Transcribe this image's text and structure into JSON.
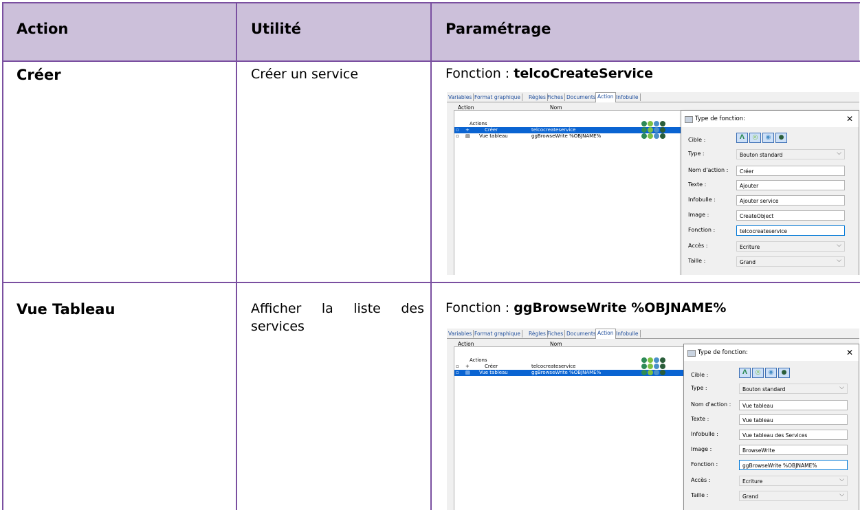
{
  "table": {
    "headers": [
      "Action",
      "Utilité",
      "Paramétrage"
    ],
    "rows": [
      {
        "action": "Créer",
        "utilite": "Créer un service",
        "fn_prefix": "Fonction : ",
        "fn_name": "telcoCreateService"
      },
      {
        "action": "Vue Tableau",
        "utilite_line1": "Afficher la liste des",
        "utilite_line2": "services",
        "fn_prefix": "Fonction : ",
        "fn_name": "ggBrowseWrite %OBJNAME%"
      }
    ]
  },
  "shots": [
    {
      "tabs": [
        "Variables",
        "Format graphique",
        "Règles",
        "Fiches",
        "Documents",
        "Action",
        "Infobulle"
      ],
      "col_action": "Action",
      "col_nom": "Nom",
      "rows": [
        {
          "label": "Actions",
          "func": ""
        },
        {
          "label": "Créer",
          "func": "telcocreateservice"
        },
        {
          "label": "Vue tableau",
          "func": "ggBrowseWrite %OBJNAME%"
        }
      ],
      "dialog": {
        "title": "Type de fonction:",
        "labels": [
          "Cible :",
          "Type :",
          "Nom d'action :",
          "Texte :",
          "Infobulle :",
          "Image :",
          "Fonction :",
          "Accès :",
          "Taille :"
        ],
        "type": "Bouton standard",
        "nom_action": "Créer",
        "texte": "Ajouter",
        "infobulle": "Ajouter service",
        "image": "CreateObject",
        "fonction": "telcocreateservice",
        "acces": "Ecriture",
        "taille": "Grand"
      }
    },
    {
      "tabs": [
        "Variables",
        "Format graphique",
        "Règles",
        "Fiches",
        "Documents",
        "Action",
        "Infobulle"
      ],
      "col_action": "Action",
      "col_nom": "Nom",
      "rows": [
        {
          "label": "Actions",
          "func": ""
        },
        {
          "label": "Créer",
          "func": "telcocreateservice"
        },
        {
          "label": "Vue tableau",
          "func": "ggBrowseWrite %OBJNAME%"
        }
      ],
      "dialog": {
        "title": "Type de fonction:",
        "labels": [
          "Cible :",
          "Type :",
          "Nom d'action :",
          "Texte :",
          "Infobulle :",
          "Image :",
          "Fonction :",
          "Accès :",
          "Taille :"
        ],
        "type": "Bouton standard",
        "nom_action": "Vue tableau",
        "texte": "Vue tableau",
        "infobulle": "Vue tableau des Services",
        "image": "BrowseWrite",
        "fonction": "ggBrowseWrite %OBJNAME%",
        "acces": "Ecriture",
        "taille": "Grand"
      }
    }
  ],
  "colors": {
    "header_bg": "#ccc0da",
    "border": "#7a4fa0",
    "selection": "#0a64d2"
  }
}
